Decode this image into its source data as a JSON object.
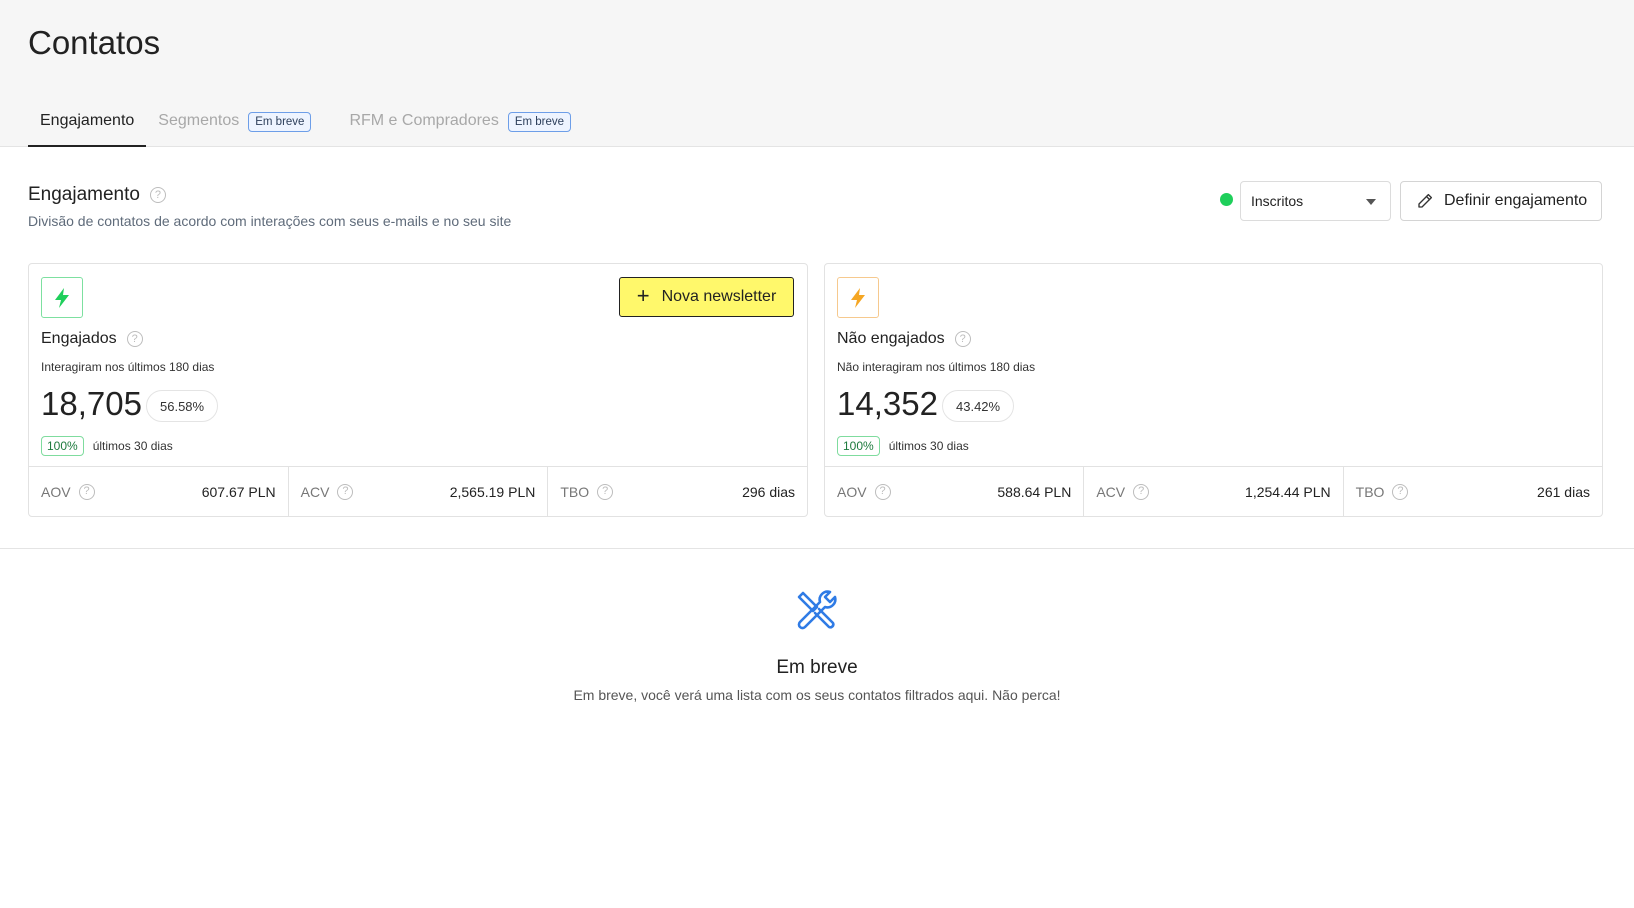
{
  "page": {
    "title": "Contatos"
  },
  "tabs": [
    {
      "label": "Engajamento",
      "active": true,
      "badge": ""
    },
    {
      "label": "Segmentos",
      "active": false,
      "badge": "Em breve"
    },
    {
      "label": "RFM e Compradores",
      "active": false,
      "badge": "Em breve"
    }
  ],
  "section": {
    "title": "Engajamento",
    "subtitle": "Divisão de contatos de acordo com interações com seus e-mails e no seu site",
    "help_icon": "?"
  },
  "filter": {
    "selected": "Inscritos",
    "status_color": "#1fcf5b"
  },
  "define_button": {
    "label": "Definir engajamento",
    "icon": "pencil-icon"
  },
  "cards": [
    {
      "icon": "lightning-icon",
      "icon_color": "#1fcf5b",
      "title": "Engajados",
      "subtitle": "Interagiram nos últimos 180 dias",
      "value": "18,705",
      "percent": "56.58%",
      "trend": "100%",
      "trend_label": "últimos 30 dias",
      "cta": "Nova newsletter",
      "metrics": [
        {
          "name": "AOV",
          "value": "607.67 PLN"
        },
        {
          "name": "ACV",
          "value": "2,565.19 PLN"
        },
        {
          "name": "TBO",
          "value": "296 dias"
        }
      ]
    },
    {
      "icon": "lightning-icon",
      "icon_color": "#f5a623",
      "title": "Não engajados",
      "subtitle": "Não interagiram nos últimos 180 dias",
      "value": "14,352",
      "percent": "43.42%",
      "trend": "100%",
      "trend_label": "últimos 30 dias",
      "metrics": [
        {
          "name": "AOV",
          "value": "588.64 PLN"
        },
        {
          "name": "ACV",
          "value": "1,254.44 PLN"
        },
        {
          "name": "TBO",
          "value": "261 dias"
        }
      ]
    }
  ],
  "empty_state": {
    "icon": "tools-icon",
    "title": "Em breve",
    "subtitle": "Em breve, você verá uma lista com os seus contatos filtrados aqui. Não perca!"
  }
}
